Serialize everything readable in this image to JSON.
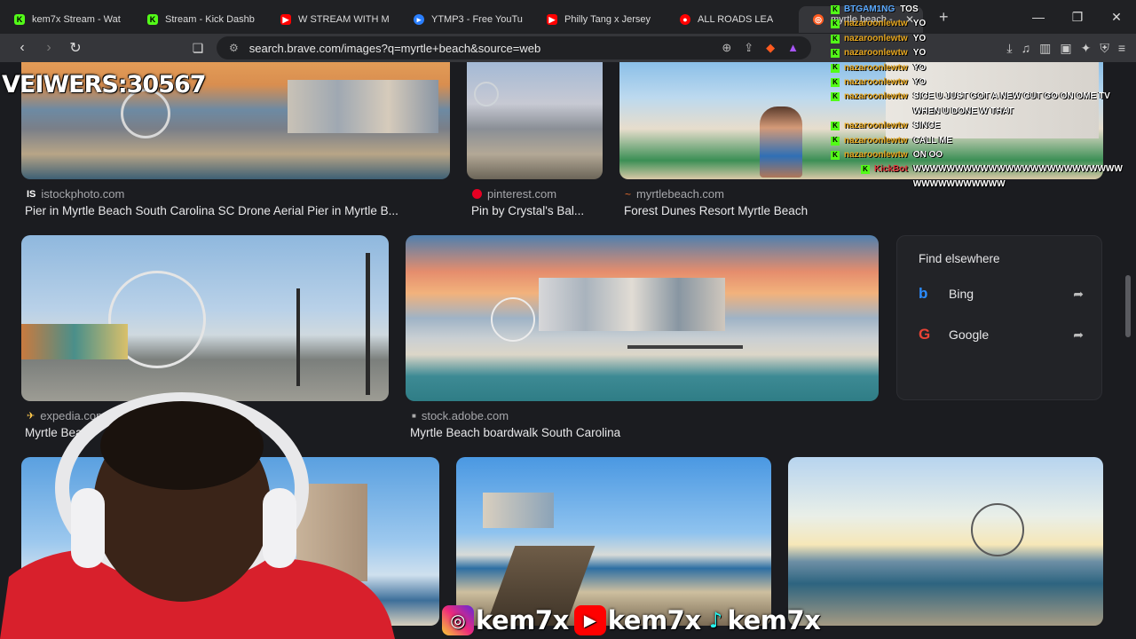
{
  "tabs": [
    {
      "title": "kem7x Stream - Wat",
      "icon": "kick-icon",
      "color": "#53fc18"
    },
    {
      "title": "Stream - Kick Dashb",
      "icon": "kick-icon",
      "color": "#53fc18"
    },
    {
      "title": "W STREAM WITH M",
      "icon": "youtube-icon",
      "color": "#ff0000"
    },
    {
      "title": "YTMP3 - Free YouTu",
      "icon": "ytmp3-icon",
      "color": "#2a7fff"
    },
    {
      "title": "Philly Tang x Jersey",
      "icon": "youtube-icon",
      "color": "#ff0000"
    },
    {
      "title": "ALL ROADS LEA",
      "icon": "youtube-icon",
      "color": "#ff0000"
    },
    {
      "title": "myrtle beach -",
      "icon": "brave-search-icon",
      "color": "#ff5a1f",
      "active": true
    }
  ],
  "new_tab": "+",
  "window": {
    "minimize": "—",
    "maximize": "❐",
    "close": "✕"
  },
  "url": "search.brave.com/images?q=myrtle+beach&source=web",
  "overlay": {
    "viewers": "VEIWERS:30567"
  },
  "results_row1": [
    {
      "source": "istockphoto.com",
      "source_icon": "IS",
      "caption": "Pier in Myrtle Beach South Carolina SC Drone Aerial Pier in Myrtle B..."
    },
    {
      "source": "pinterest.com",
      "source_icon": "P",
      "caption": "Pin by Crystal's Bal..."
    },
    {
      "source": "myrtlebeach.com",
      "source_icon": "~",
      "caption": "Forest Dunes Resort Myrtle Beach"
    }
  ],
  "results_row2": [
    {
      "source": "expedia.com",
      "source_icon": "✈",
      "caption": "Myrtle Beach"
    },
    {
      "source": "stock.adobe.com",
      "source_icon": "■",
      "caption": "Myrtle Beach boardwalk South Carolina"
    }
  ],
  "find_elsewhere": {
    "heading": "Find elsewhere",
    "engines": [
      {
        "name": "Bing",
        "icon": "b",
        "color": "#2b8cff"
      },
      {
        "name": "Google",
        "icon": "G",
        "color": "#ea4335"
      }
    ]
  },
  "chat": [
    {
      "user": "BTGAM1NG",
      "text": "TOS"
    },
    {
      "user": "nazaroonlewtw",
      "text": "YO"
    },
    {
      "user": "nazaroonlewtw",
      "text": "YO"
    },
    {
      "user": "nazaroonlewtw",
      "text": "YO"
    },
    {
      "user": "nazaroonlewtw",
      "text": "YO"
    },
    {
      "user": "nazaroonlewtw",
      "text": "YO"
    },
    {
      "user": "nazaroonlewtw",
      "text": "SICE U JUST GOT A NEW CUT GO ON OME TV WHEN U DONE W THAT"
    },
    {
      "user": "nazaroonlewtw",
      "text": "SINCE"
    },
    {
      "user": "nazaroonlewtw",
      "text": "CALL ME"
    },
    {
      "user": "nazaroonlewtw",
      "text": "ON OO"
    },
    {
      "user": "KickBot",
      "text": "WWWWWWWWWWWWWWWWWWWWWWWWWWWWWWWWWWWW"
    }
  ],
  "socials": [
    {
      "platform": "instagram-icon",
      "handle": "kem7x"
    },
    {
      "platform": "youtube-icon",
      "handle": "kem7x"
    },
    {
      "platform": "tiktok-icon",
      "handle": "kem7x"
    }
  ]
}
